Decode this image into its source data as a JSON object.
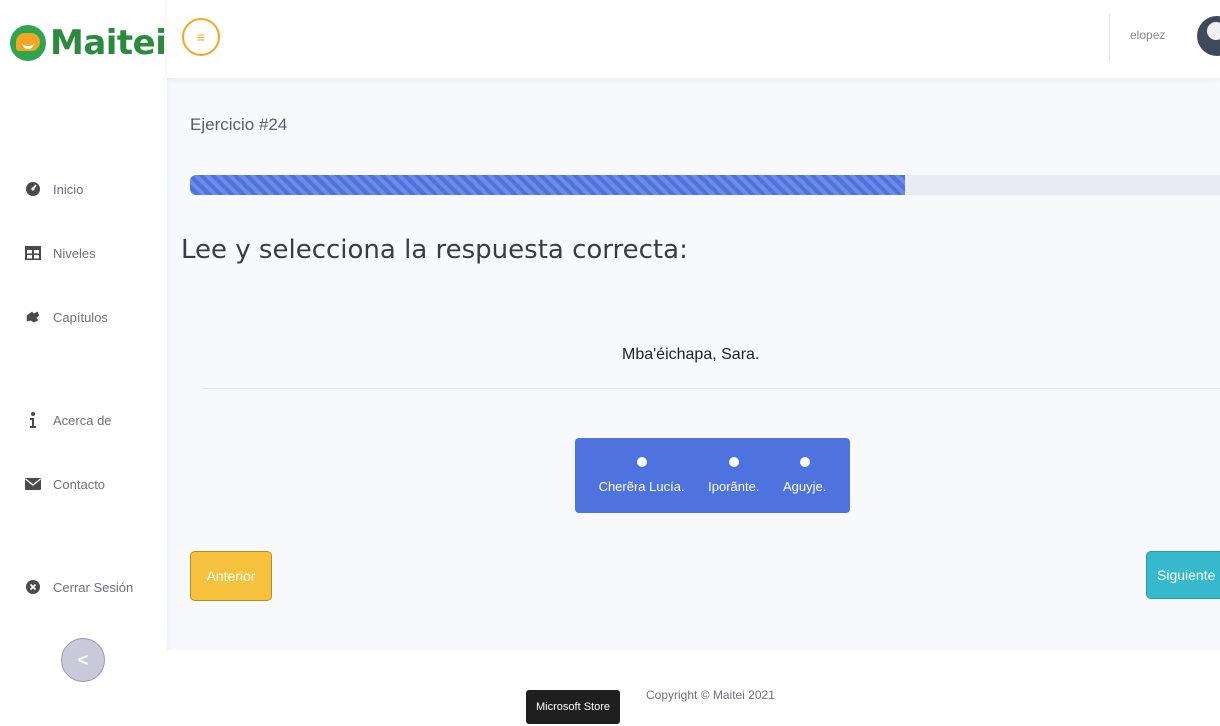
{
  "brand": {
    "name": "Maitei"
  },
  "topbar": {
    "username": "elopez",
    "menu_icon": "≡"
  },
  "sidebar": {
    "items": [
      {
        "label": "Inicio",
        "icon": "tachometer-icon"
      },
      {
        "label": "Niveles",
        "icon": "table-icon"
      },
      {
        "label": "Capítulos",
        "icon": "puzzle-icon"
      },
      {
        "label": "Acerca de",
        "icon": "info-icon"
      },
      {
        "label": "Contacto",
        "icon": "envelope-icon"
      },
      {
        "label": "Cerrar Sesión",
        "icon": "close-circle-icon"
      }
    ],
    "collapse_label": "<"
  },
  "main": {
    "exercise_title": "Ejercicio #24",
    "progress_fraction": 0.694,
    "instruction": "Lee y selecciona la respuesta correcta:",
    "prompt": "Mba'éichapa, Sara.",
    "options": [
      {
        "label": "Cherẽra Lucía."
      },
      {
        "label": "Iporãnte."
      },
      {
        "label": "Aguyje."
      }
    ],
    "prev_label": "Anterior",
    "next_label": "Siguiente"
  },
  "footer": {
    "copyright": "Copyright © Maitei 2021",
    "store_tag": "Microsoft Store"
  },
  "colors": {
    "primary": "#4e73df",
    "warning": "#f6c23e",
    "info": "#36b9cc",
    "brand_green": "#2b8a3e",
    "brand_orange": "#f6a623"
  }
}
